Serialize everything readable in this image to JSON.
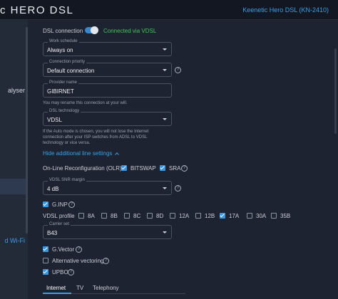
{
  "header": {
    "brand": "HERO DSL",
    "model": "Keenetic Hero DSL (KN-2410)"
  },
  "sidebar": {
    "items": [
      {
        "label": "alyser"
      },
      {
        "label": "d Wi-Fi"
      }
    ]
  },
  "dsl": {
    "label": "DSL connection",
    "status": "Connected via VDSL",
    "status_color": "#49c25a"
  },
  "work_schedule": {
    "label": "Work schedule",
    "value": "Always on"
  },
  "priority": {
    "label": "Connection priority",
    "value": "Default connection"
  },
  "provider": {
    "label": "Provider name",
    "value": "GIBIRNET",
    "hint": "You may rename this connection at your will."
  },
  "technology": {
    "label": "DSL technology",
    "value": "VDSL",
    "hint_line1": "If the Auto mode is chosen, you will not lose the Internet",
    "hint_line2": "connection after your ISP switches from ADSL to VDSL",
    "hint_line3": "technology or vice versa."
  },
  "hide_link": "Hide additional line settings",
  "olr": {
    "label": "On-Line Reconfiguration (OLR)",
    "bitswap": "BITSWAP",
    "sra": "SRA"
  },
  "snr": {
    "label": "VDSL SNR margin",
    "value": "4 dB"
  },
  "ginp": "G.INP",
  "profile": {
    "label": "VDSL profile",
    "options": [
      {
        "name": "8A",
        "checked": false
      },
      {
        "name": "8B",
        "checked": false
      },
      {
        "name": "8C",
        "checked": false
      },
      {
        "name": "8D",
        "checked": false
      },
      {
        "name": "12A",
        "checked": false
      },
      {
        "name": "12B",
        "checked": false
      },
      {
        "name": "17A",
        "checked": true
      },
      {
        "name": "30A",
        "checked": false
      },
      {
        "name": "35B",
        "checked": false
      }
    ]
  },
  "carrier": {
    "label": "Carrier set",
    "value": "B43"
  },
  "gvector": "G.Vector",
  "alt_vectoring": "Alternative vectoring",
  "upbo": "UPBO",
  "tabs": [
    {
      "label": "Internet"
    },
    {
      "label": "TV"
    },
    {
      "label": "Telephony"
    }
  ],
  "colors": {
    "accent": "#3aa0e8",
    "background": "#1d2330",
    "header": "#121722"
  }
}
